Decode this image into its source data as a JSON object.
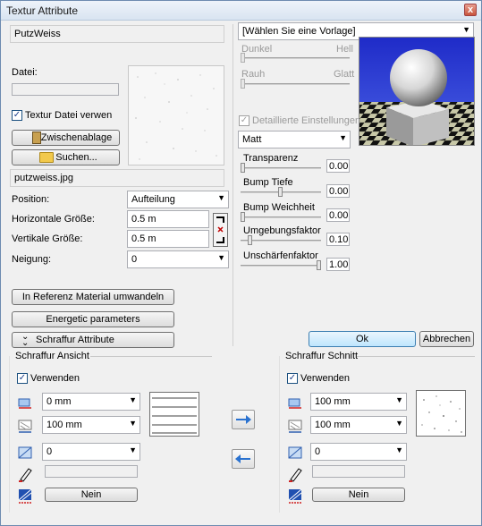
{
  "window": {
    "title": "Textur Attribute",
    "close_glyph": "x"
  },
  "left": {
    "name_field": "PutzWeiss",
    "datei_label": "Datei:",
    "datei_value": "",
    "textur_checkbox_label": "Textur Datei verwen",
    "zwischenablage_label": "Zwischenablage",
    "suchen_label": "Suchen...",
    "filename": "putzweiss.jpg",
    "position_label": "Position:",
    "position_value": "Aufteilung",
    "horizontal_label": "Horizontale Größe:",
    "horizontal_value": "0.5 m",
    "vertical_label": "Vertikale Größe:",
    "vertical_value": "0.5 m",
    "neigung_label": "Neigung:",
    "neigung_value": "0",
    "referenz_button": "In Referenz Material umwandeln",
    "energetic_button": "Energetic parameters",
    "schraffur_button": "Schraffur Attribute"
  },
  "right": {
    "vorlage_value": "[Wählen Sie eine Vorlage]",
    "dunkel": "Dunkel",
    "hell": "Hell",
    "rauh": "Rauh",
    "glatt": "Glatt",
    "detail_label": "Detaillierte Einstellungen",
    "finish_value": "Matt",
    "transparenz_label": "Transparenz",
    "transparenz_value": "0.00",
    "bump_tiefe_label": "Bump Tiefe",
    "bump_tiefe_value": "0.00",
    "bump_weich_label": "Bump Weichheit",
    "bump_weich_value": "0.00",
    "umgebung_label": "Umgebungsfaktor",
    "umgebung_value": "0.10",
    "unschaerfe_label": "Unschärfenfaktor",
    "unschaerfe_value": "1.00",
    "ok_label": "Ok",
    "abbrechen_label": "Abbrechen"
  },
  "schraffur_ansicht": {
    "title": "Schraffur Ansicht",
    "verwenden": "Verwenden",
    "combo1": "0 mm",
    "combo2": "100 mm",
    "combo3": "0",
    "nein": "Nein"
  },
  "schraffur_schnitt": {
    "title": "Schraffur Schnitt",
    "verwenden": "Verwenden",
    "combo1": "100 mm",
    "combo2": "100 mm",
    "combo3": "0",
    "nein": "Nein"
  },
  "icons": {
    "copy_right": "arrow-right-icon",
    "copy_left": "arrow-left-icon"
  }
}
